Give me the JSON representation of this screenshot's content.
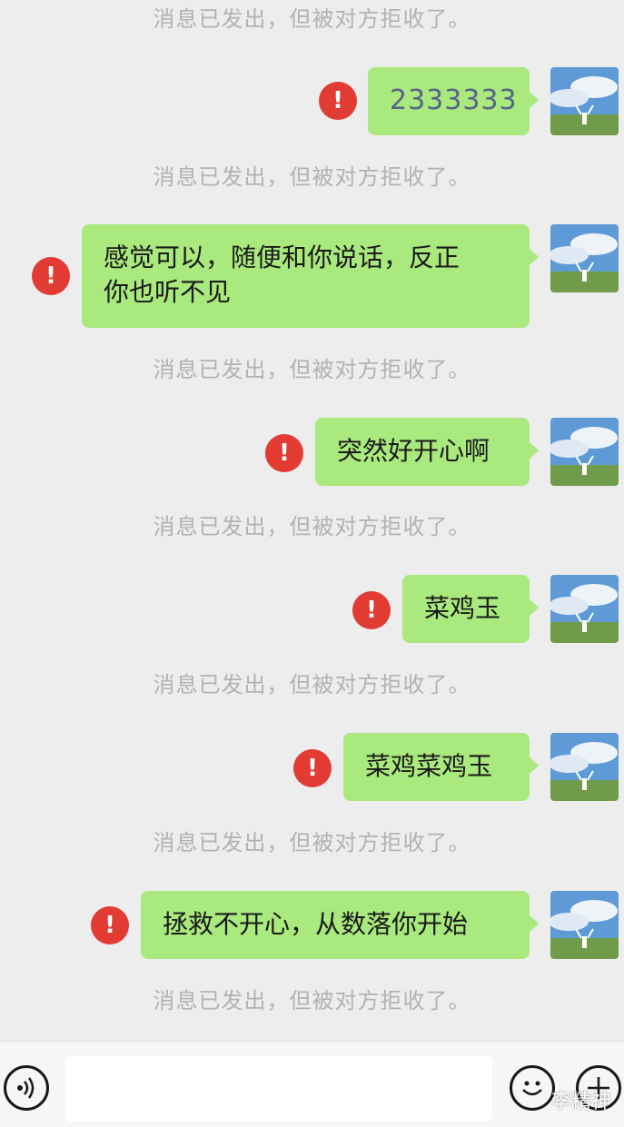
{
  "notice_text": "消息已发出，但被对方拒收了。",
  "error_symbol": "!",
  "messages": [
    {
      "text": "2333333"
    },
    {
      "line1": "感觉可以，随便和你说话，反正",
      "line2": "你也听不见"
    },
    {
      "text": "突然好开心啊"
    },
    {
      "text": "菜鸡玉"
    },
    {
      "text": "菜鸡菜鸡玉"
    },
    {
      "text": "拯救不开心，从数落你开始"
    }
  ],
  "input_bar": {
    "icons": [
      "voice-icon",
      "emoji-icon",
      "plus-icon"
    ],
    "textbox_value": ""
  },
  "watermark": "李精神",
  "colors": {
    "background": "#ededed",
    "bubble": "#a9e97d",
    "error": "#e23b33",
    "notice": "#b2b2b2"
  }
}
